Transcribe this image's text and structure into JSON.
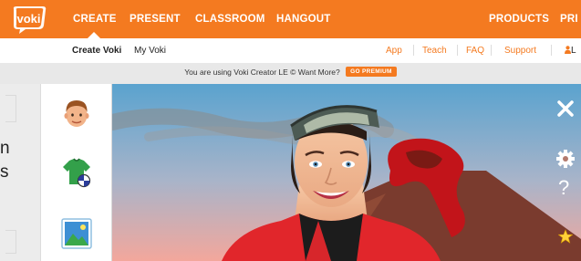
{
  "logo": {
    "text": "voki",
    "icon": "voki-logo"
  },
  "topnav": {
    "items": [
      "CREATE",
      "PRESENT",
      "CLASSROOM",
      "HANGOUT"
    ],
    "right_items": [
      "PRODUCTS",
      "PRI"
    ],
    "active": "CREATE"
  },
  "subnav": {
    "left": [
      "Create Voki",
      "My Voki"
    ],
    "right": [
      "App",
      "Teach",
      "FAQ",
      "Support"
    ],
    "login": "L"
  },
  "banner": {
    "text": "You are using Voki Creator LE © Want More?",
    "button": "GO PREMIUM"
  },
  "left_clip": [
    "n",
    "s"
  ],
  "toolbar": {
    "tools": [
      {
        "icon": "character-head-icon"
      },
      {
        "icon": "clothing-shirt-icon"
      },
      {
        "icon": "background-image-icon"
      }
    ]
  },
  "stage": {
    "controls": [
      "close-icon",
      "settings-gear-icon",
      "help-icon",
      "star-icon"
    ],
    "help_glyph": "?"
  },
  "colors": {
    "brand_orange": "#f47a20",
    "band_gray": "#e8e8e8",
    "sky_top": "#5aa3cf",
    "sky_bottom": "#f3a79c",
    "volcano": "#7a3b2e",
    "lava": "#c2141a"
  }
}
